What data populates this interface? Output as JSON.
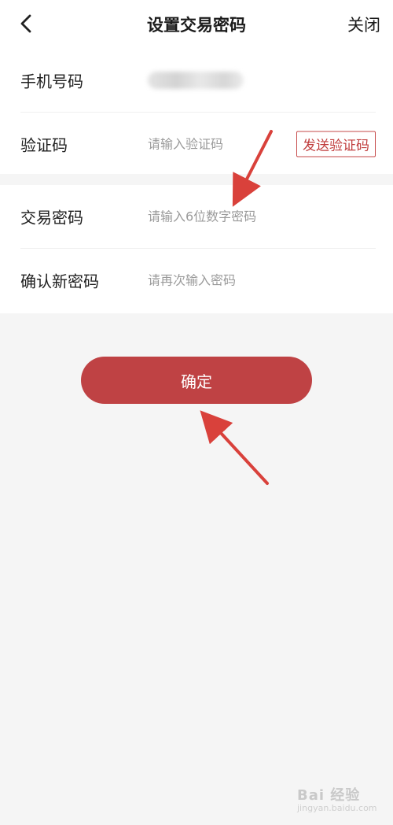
{
  "header": {
    "back_icon": "chevron-left-icon",
    "title": "设置交易密码",
    "close_label": "关闭"
  },
  "form": {
    "phone": {
      "label": "手机号码"
    },
    "verify_code": {
      "label": "验证码",
      "placeholder": "请输入验证码",
      "send_button": "发送验证码"
    },
    "trade_password": {
      "label": "交易密码",
      "placeholder": "请输入6位数字密码"
    },
    "confirm_password": {
      "label": "确认新密码",
      "placeholder": "请再次输入密码"
    }
  },
  "confirm_button": "确定",
  "watermark": {
    "text": "Bai 经验",
    "sub": "jingyan.baidu.com"
  },
  "colors": {
    "accent": "#bf4244",
    "send_button_border": "#c64a4a",
    "annotation_arrow": "#d9413b"
  }
}
